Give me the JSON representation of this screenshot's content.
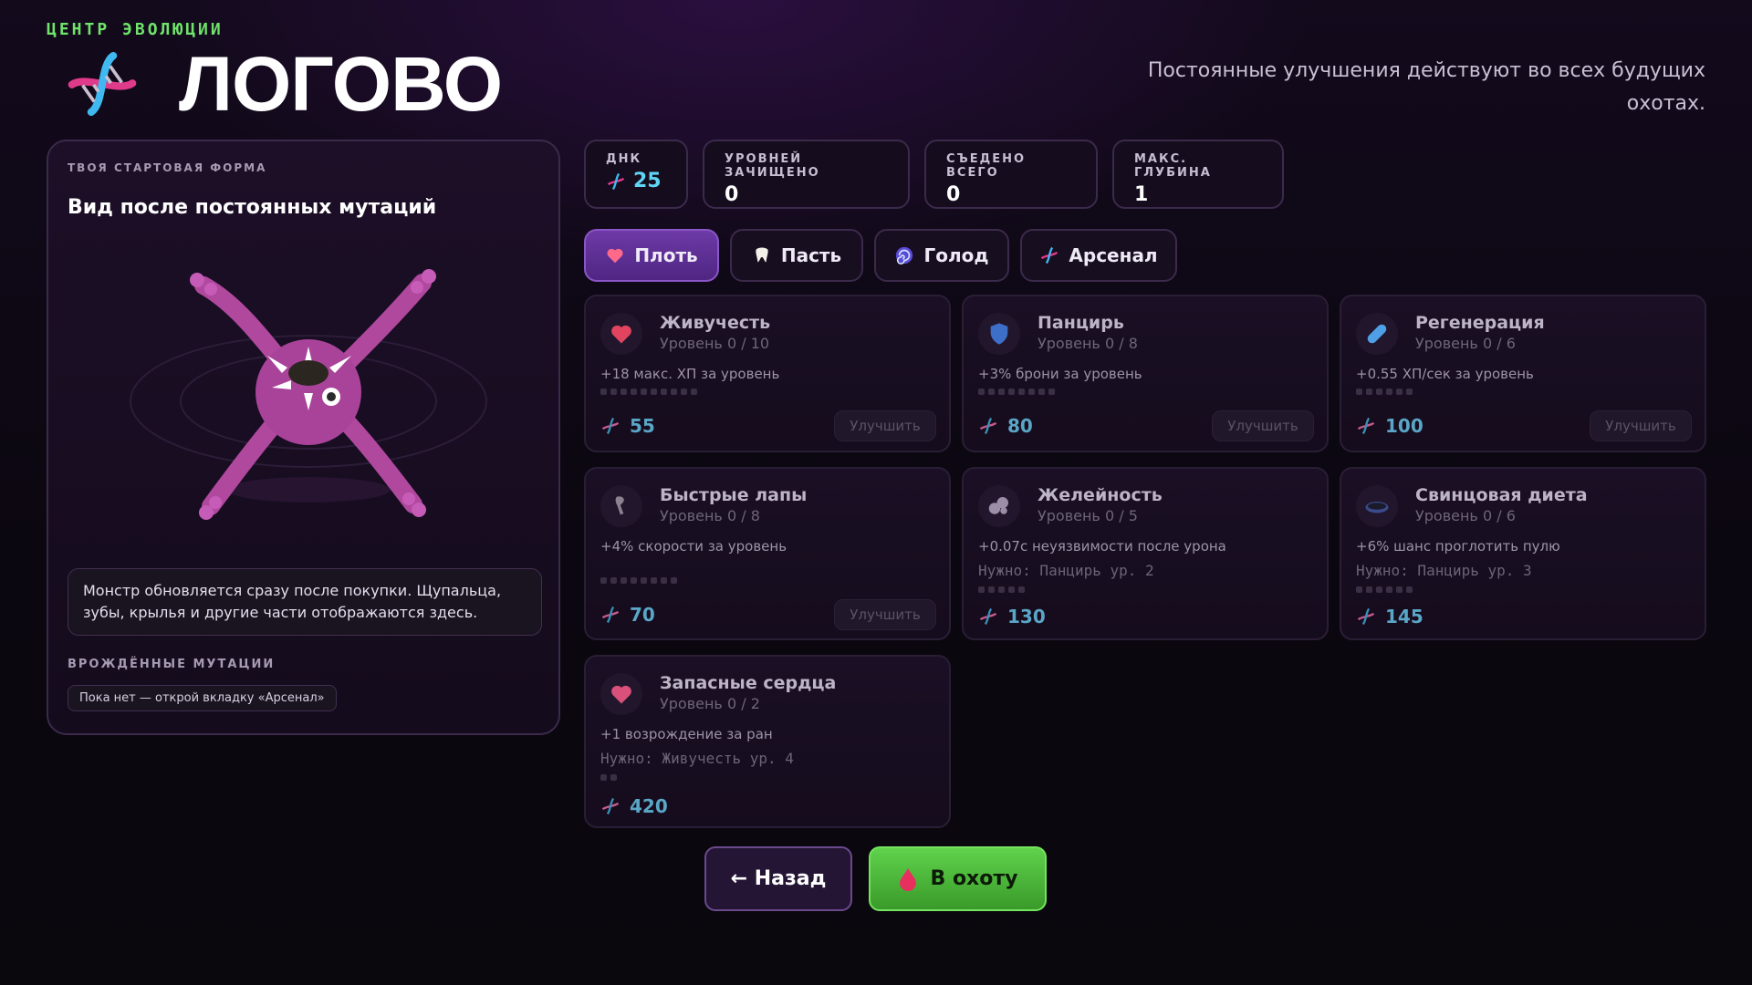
{
  "header": {
    "kicker": "ЦЕНТР ЭВОЛЮЦИИ",
    "title": "ЛОГОВО",
    "subtitle": "Постоянные улучшения действуют во всех будущих охотах."
  },
  "left_panel": {
    "kicker": "ТВОЯ СТАРТОВАЯ ФОРМА",
    "title": "Вид после постоянных мутаций",
    "note": "Монстр обновляется сразу после покупки. Щупальца, зубы, крылья и другие части отображаются здесь.",
    "innate_kicker": "ВРОЖДЁННЫЕ МУТАЦИИ",
    "innate_empty": "Пока нет — открой вкладку «Арсенал»"
  },
  "stats": [
    {
      "label": "ДНК",
      "value": "25",
      "icon": "dna-icon"
    },
    {
      "label": "УРОВНЕЙ ЗАЧИЩЕНО",
      "value": "0"
    },
    {
      "label": "СЪЕДЕНО ВСЕГО",
      "value": "0"
    },
    {
      "label": "МАКС. ГЛУБИНА",
      "value": "1"
    }
  ],
  "tabs": [
    {
      "label": "Плоть",
      "icon": "heart-icon",
      "active": true
    },
    {
      "label": "Пасть",
      "icon": "tooth-icon",
      "active": false
    },
    {
      "label": "Голод",
      "icon": "spiral-icon",
      "active": false
    },
    {
      "label": "Арсенал",
      "icon": "dna-icon",
      "active": false
    }
  ],
  "upgrades": [
    {
      "name": "Живучесть",
      "level": "Уровень 0 / 10",
      "desc": "+18 макс. ХП за уровень",
      "requirement": "",
      "price": "55",
      "button": "Улучшить",
      "max": 10,
      "icon": "heart-icon",
      "color": "#e0445e"
    },
    {
      "name": "Панцирь",
      "level": "Уровень 0 / 8",
      "desc": "+3% брони за уровень",
      "requirement": "",
      "price": "80",
      "button": "Улучшить",
      "max": 8,
      "icon": "shield-icon",
      "color": "#3d6fc9"
    },
    {
      "name": "Регенерация",
      "level": "Уровень 0 / 6",
      "desc": "+0.55 ХП/сек за уровень",
      "requirement": "",
      "price": "100",
      "button": "Улучшить",
      "max": 6,
      "icon": "pill-icon",
      "color": "#4f9fe6"
    },
    {
      "name": "Быстрые лапы",
      "level": "Уровень 0 / 8",
      "desc": "+4% скорости за уровень",
      "requirement": "",
      "price": "70",
      "button": "Улучшить",
      "max": 8,
      "icon": "leg-icon",
      "color": "#8a8290"
    },
    {
      "name": "Желейность",
      "level": "Уровень 0 / 5",
      "desc": "+0.07с неуязвимости после урона",
      "requirement": "Нужно: Панцирь ур. 2",
      "price": "130",
      "button": "",
      "max": 5,
      "icon": "blob-icon",
      "color": "#9b8ea6"
    },
    {
      "name": "Свинцовая диета",
      "level": "Уровень 0 / 6",
      "desc": "+6% шанс проглотить пулю",
      "requirement": "Нужно: Панцирь ур. 3",
      "price": "145",
      "button": "",
      "max": 6,
      "icon": "disc-icon",
      "color": "#3a4a8a"
    },
    {
      "name": "Запасные сердца",
      "level": "Уровень 0 / 2",
      "desc": "+1 возрождение за ран",
      "requirement": "Нужно: Живучесть ур. 4",
      "price": "420",
      "button": "",
      "max": 2,
      "icon": "heart-icon",
      "color": "#d9507a"
    }
  ],
  "buttons": {
    "back": "← Назад",
    "hunt": "В охоту"
  },
  "colors": {
    "accent_green": "#6fe36a",
    "dna_blue": "#5fd5f5",
    "tab_active": "#6d3aa6",
    "monster": "#b0489e"
  }
}
